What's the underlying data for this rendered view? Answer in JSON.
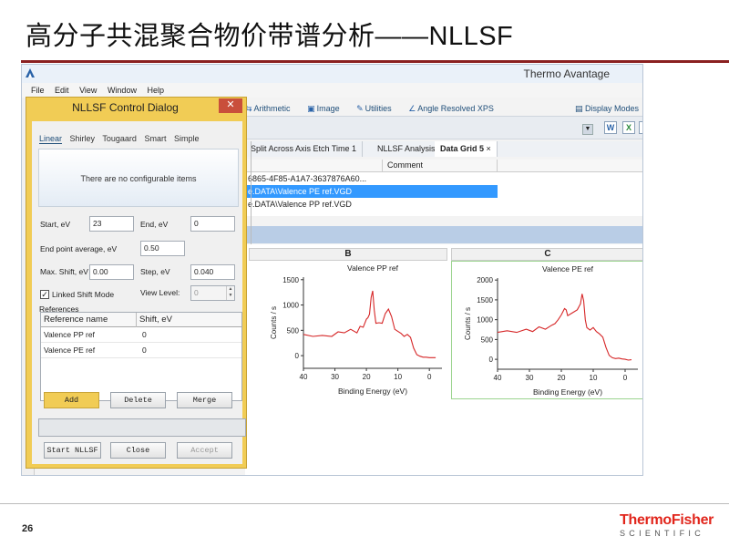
{
  "slide": {
    "title": "高分子共混聚合物价带谱分析——NLLSF",
    "page_number": "26",
    "logo_top": "ThermoFisher",
    "logo_bottom": "SCIENTIFIC"
  },
  "app": {
    "title": "Thermo Avantage",
    "menu": [
      "File",
      "Edit",
      "View",
      "Window",
      "Help"
    ],
    "ribbon": [
      "Arithmetic",
      "Image",
      "Utilities",
      "Angle Resolved XPS"
    ],
    "display_modes": "Display Modes",
    "tabs": [
      "Split Across Axis Etch Time 1",
      "NLLSF Analysis",
      "Data Grid 5"
    ],
    "tab_close": "×",
    "grid": {
      "comment_header": "Comment",
      "rows": [
        "6865-4F85-A1A7-3637876A60...",
        "e.DATA\\Valence PE ref.VGD",
        "e.DATA\\Valence PP ref.VGD"
      ]
    },
    "columns": [
      "B",
      "C"
    ]
  },
  "dialog": {
    "title": "NLLSF Control Dialog",
    "close": "✕",
    "method_tabs": [
      "Linear",
      "Shirley",
      "Tougaard",
      "Smart",
      "Simple"
    ],
    "no_items": "There are no configurable items",
    "start_label": "Start, eV",
    "start_value": "23",
    "end_label": "End, eV",
    "end_value": "0",
    "endpoint_label": "End point average, eV",
    "endpoint_value": "0.50",
    "maxshift_label": "Max. Shift, eV",
    "maxshift_value": "0.00",
    "step_label": "Step, eV",
    "step_value": "0.040",
    "linked_label": "Linked Shift Mode",
    "viewlevel_label": "View Level:",
    "viewlevel_value": "0",
    "references_label": "References",
    "ref_headers": [
      "Reference name",
      "Shift, eV"
    ],
    "ref_rows": [
      {
        "name": "Valence PP ref",
        "shift": "0"
      },
      {
        "name": "Valence PE ref",
        "shift": "0"
      }
    ],
    "buttons": {
      "add": "Add",
      "delete": "Delete",
      "merge": "Merge",
      "start": "Start NLLSF",
      "close": "Close",
      "accept": "Accept"
    }
  },
  "chart_data": [
    {
      "type": "line",
      "title": "Valence PP ref",
      "xlabel": "Binding Energy (eV)",
      "ylabel": "Counts / s",
      "xlim": [
        40,
        -4
      ],
      "ylim": [
        -250,
        1550
      ],
      "xticks": [
        40,
        30,
        20,
        10,
        0
      ],
      "yticks": [
        0,
        500,
        1000,
        1500
      ],
      "series": [
        {
          "x": [
            40,
            37,
            34,
            31,
            29,
            27,
            25,
            23,
            22,
            21,
            20,
            19.5,
            19,
            18.5,
            18,
            17.5,
            17,
            16,
            15,
            14,
            13,
            12,
            11,
            10,
            9,
            8,
            7,
            6,
            5,
            4,
            3,
            2,
            1,
            0,
            -1,
            -2
          ],
          "y": [
            420,
            380,
            400,
            380,
            470,
            450,
            520,
            450,
            580,
            560,
            720,
            750,
            820,
            1150,
            1280,
            900,
            640,
            650,
            640,
            830,
            920,
            770,
            520,
            480,
            440,
            380,
            420,
            360,
            150,
            20,
            -10,
            -30,
            -30,
            -40,
            -40,
            -40
          ]
        }
      ]
    },
    {
      "type": "line",
      "title": "Valence PE ref",
      "xlabel": "Binding Energy (eV)",
      "ylabel": "Counts / s",
      "xlim": [
        40,
        -4
      ],
      "ylim": [
        -250,
        2050
      ],
      "xticks": [
        40,
        30,
        20,
        10,
        0
      ],
      "yticks": [
        0,
        500,
        1000,
        1500,
        2000
      ],
      "series": [
        {
          "x": [
            40,
            37,
            34,
            31,
            29,
            27,
            25,
            23,
            22,
            21,
            20,
            19,
            18.5,
            18,
            17,
            16,
            15,
            14,
            13.5,
            13,
            12.5,
            12,
            11,
            10,
            9,
            8,
            7,
            6,
            5,
            4,
            3,
            2,
            1,
            0,
            -1,
            -2
          ],
          "y": [
            680,
            720,
            680,
            760,
            700,
            820,
            760,
            860,
            900,
            1000,
            1120,
            1280,
            1250,
            1100,
            1150,
            1200,
            1250,
            1400,
            1650,
            1480,
            1000,
            800,
            740,
            800,
            700,
            640,
            560,
            300,
            100,
            40,
            20,
            30,
            10,
            0,
            -20,
            -10
          ]
        }
      ]
    }
  ]
}
